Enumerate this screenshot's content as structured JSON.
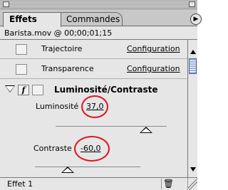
{
  "window": {
    "tabs": [
      {
        "label": "Effets",
        "active": true
      },
      {
        "label": "Commandes",
        "active": false
      }
    ],
    "menu_icon": "palette-menu-icon"
  },
  "clip": {
    "header": "Barista.mov @ 00;00;01;15"
  },
  "effects": [
    {
      "name": "Trajectoire",
      "link": "Configuration",
      "enabled": false
    },
    {
      "name": "Transparence",
      "link": "Configuration",
      "enabled": false
    }
  ],
  "effect": {
    "fx_label": "f",
    "name": "Luminosité/Contraste",
    "params": [
      {
        "label": "Luminosité",
        "value": "37,0"
      },
      {
        "label": "Contraste",
        "value": "-60,0"
      }
    ]
  },
  "footer": {
    "label": "Effet 1",
    "trash_icon": "trash-icon"
  },
  "colors": {
    "highlight_ring": "#e0141e",
    "panel_bg": "#e6e6e6"
  }
}
